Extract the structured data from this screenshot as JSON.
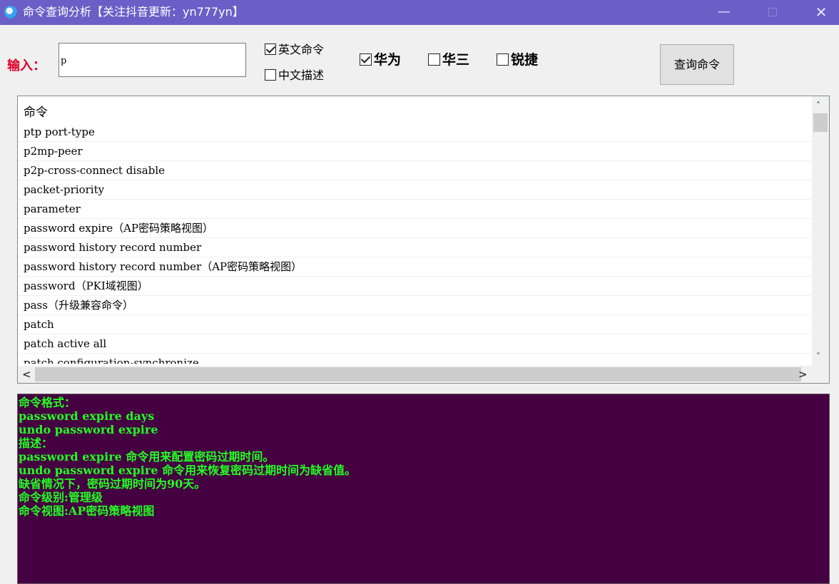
{
  "window": {
    "title": "命令查询分析【关注抖音更新：yn777yn】",
    "min_glyph": "—",
    "close_glyph": "✕"
  },
  "search": {
    "label": "输入：",
    "value": "p"
  },
  "options": {
    "english_cmd": {
      "label": "英文命令",
      "checked": true
    },
    "chinese_desc": {
      "label": "中文描述",
      "checked": false
    }
  },
  "vendors": [
    {
      "label": "华为",
      "checked": true
    },
    {
      "label": "华三",
      "checked": false
    },
    {
      "label": "锐捷",
      "checked": false
    }
  ],
  "query_button": {
    "label": "查询命令"
  },
  "command_list": {
    "header": "命令",
    "rows": [
      "ptp port-type",
      "p2mp-peer",
      "p2p-cross-connect disable",
      "packet-priority",
      "parameter",
      "password expire（AP密码策略视图）",
      "password history record number",
      "password history record number（AP密码策略视图）",
      "password（PKI域视图）",
      "pass（升级兼容命令）",
      "patch",
      "patch active all",
      "patch configuration-synchronize"
    ]
  },
  "scrollbars": {
    "up": "˄",
    "down": "˅",
    "left": "<",
    "right": ">"
  },
  "detail": {
    "lines": [
      "命令格式：",
      "password expire days",
      "undo password expire",
      "描述：",
      "password expire 命令用来配置密码过期时间。",
      "undo password expire 命令用来恢复密码过期时间为缺省值。",
      "缺省情况下，密码过期时间为90天。",
      "命令级别:管理级",
      "命令视图:AP密码策略视图"
    ]
  },
  "colors": {
    "titlebar": "#6b5fc7",
    "input_label": "#e0002a",
    "detail_bg": "#440040",
    "detail_text": "#22ff22"
  }
}
